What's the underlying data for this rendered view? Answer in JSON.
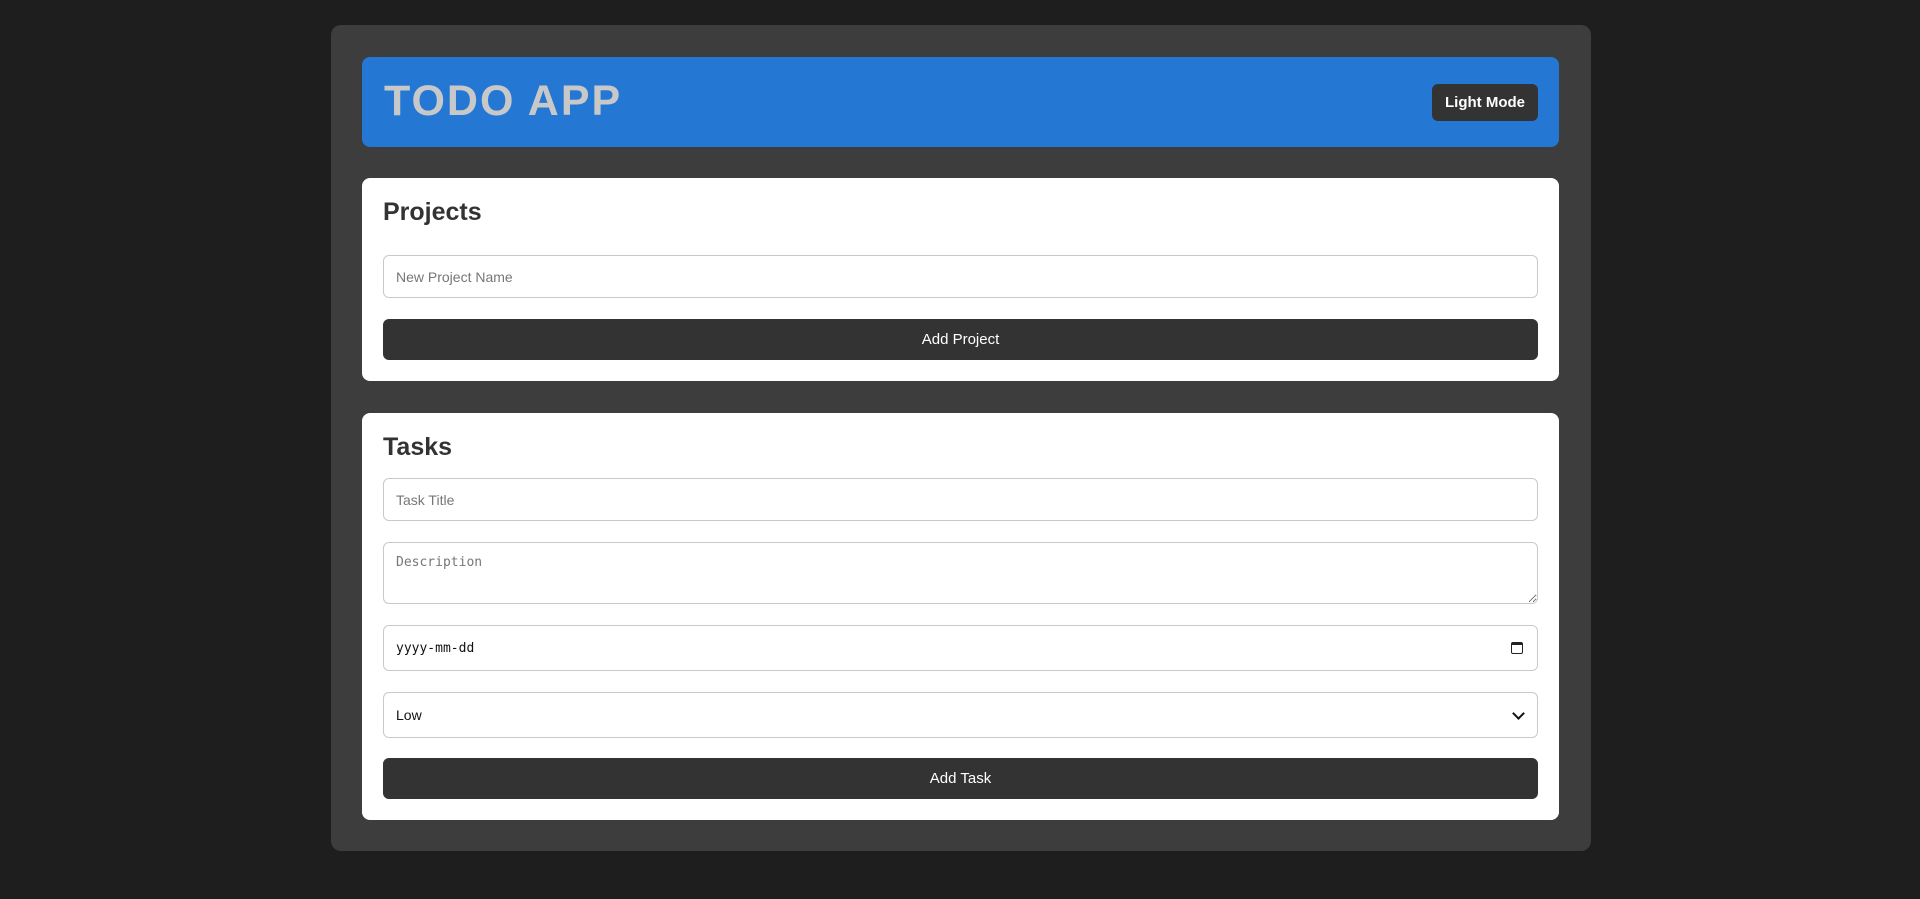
{
  "header": {
    "title": "TODO APP",
    "mode_button_label": "Light Mode"
  },
  "projects": {
    "title": "Projects",
    "name_placeholder": "New Project Name",
    "add_label": "Add Project"
  },
  "tasks": {
    "title": "Tasks",
    "title_placeholder": "Task Title",
    "description_placeholder": "Description",
    "date_placeholder": "yyyy-mm-dd",
    "priority_selected": "Low",
    "add_label": "Add Task"
  },
  "colors": {
    "page_background": "#1e1e1e",
    "container_background": "#3d3d3d",
    "header_accent": "#2478d4",
    "button_dark": "#333333",
    "card_background": "#ffffff"
  }
}
